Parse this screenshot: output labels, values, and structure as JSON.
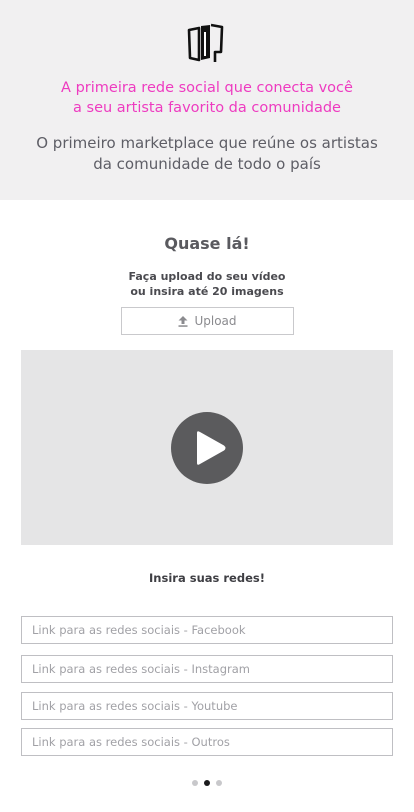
{
  "header": {
    "logo_icon": "brand-logo-icon",
    "tagline_line1": "A primeira rede social que conecta você",
    "tagline_line2": "a seu artista favorito da comunidade",
    "subline_line1": "O primeiro marketplace que reúne os artistas",
    "subline_line2": "da comunidade de todo o país",
    "tagline_color": "#ee3bc0"
  },
  "main": {
    "title": "Quase lá!",
    "upload_text_line1": "Faça upload do seu vídeo",
    "upload_text_line2": "ou insira até 20 imagens",
    "upload_button_label": "Upload",
    "upload_icon": "upload-arrow-icon",
    "video_icon": "play-icon",
    "networks_title": "Insira suas redes!",
    "fields": [
      {
        "placeholder": "Link para as redes sociais - Facebook"
      },
      {
        "placeholder": "Link para as redes sociais - Instagram"
      },
      {
        "placeholder": "Link para as redes sociais - Youtube"
      },
      {
        "placeholder": "Link para as redes sociais - Outros"
      }
    ]
  },
  "pagination": {
    "total": 3,
    "current": 2
  }
}
